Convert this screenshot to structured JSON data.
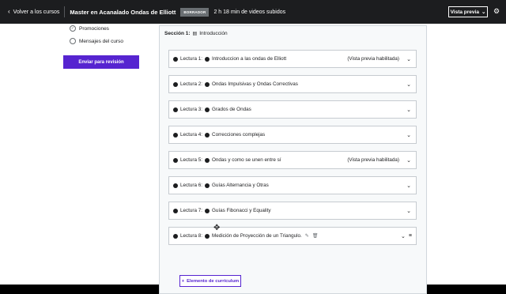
{
  "topbar": {
    "back_label": "Volver a los cursos",
    "course_title": "Master en Acanalado Ondas de Elliott",
    "status_badge": "BORRADOR",
    "uploaded_text": "2 h 18 min de videos subidos",
    "preview_label": "Vista previa"
  },
  "sidebar": {
    "items": [
      {
        "label": "Promociones",
        "checked": true
      },
      {
        "label": "Mensajes del curso",
        "checked": false
      }
    ],
    "submit_label": "Enviar para revisión"
  },
  "section": {
    "prefix": "Sección 1:",
    "title": "Introducción"
  },
  "lectures": [
    {
      "label": "Lectura 1:",
      "name": "Introduccion a las ondas de Elliott",
      "preview": "(Vista previa habilitada)"
    },
    {
      "label": "Lectura 2:",
      "name": "Ondas Impulsivas y Ondas Correctivas",
      "preview": ""
    },
    {
      "label": "Lectura 3:",
      "name": "Grados de Ondas",
      "preview": ""
    },
    {
      "label": "Lectura 4:",
      "name": "Correcciones complejas",
      "preview": ""
    },
    {
      "label": "Lectura 5:",
      "name": "Ondas y como se unen entre sí",
      "preview": "(Vista previa habilitada)"
    },
    {
      "label": "Lectura 6:",
      "name": "Guías Alternancia y Otras",
      "preview": ""
    },
    {
      "label": "Lectura 7:",
      "name": "Guías Fibonacci y Equality",
      "preview": ""
    },
    {
      "label": "Lectura 8:",
      "name": "Medición de Proyección de un Triangulo.",
      "preview": ""
    }
  ],
  "add_item_label": "Elemento de currículum"
}
